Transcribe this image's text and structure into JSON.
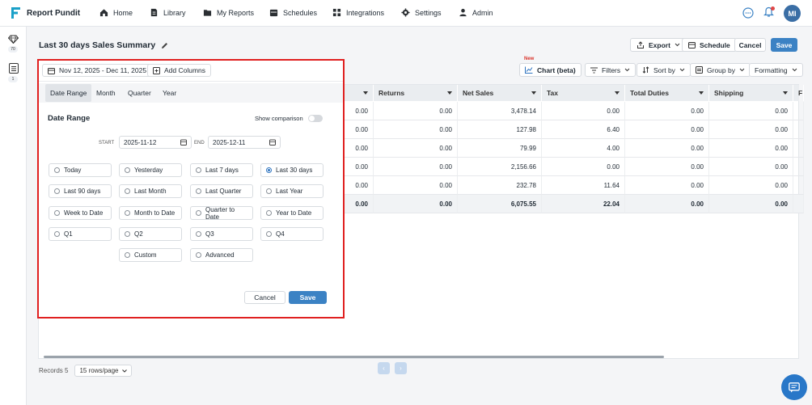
{
  "app": {
    "name": "Report Pundit",
    "avatar_initials": "MI"
  },
  "nav": [
    {
      "label": "Home",
      "icon": "home-icon"
    },
    {
      "label": "Library",
      "icon": "library-icon"
    },
    {
      "label": "My Reports",
      "icon": "folder-icon"
    },
    {
      "label": "Schedules",
      "icon": "calendar-icon"
    },
    {
      "label": "Integrations",
      "icon": "grid-icon"
    },
    {
      "label": "Settings",
      "icon": "gear-icon"
    },
    {
      "label": "Admin",
      "icon": "user-icon"
    }
  ],
  "rail": {
    "templates_count": "70",
    "reports_count": "1"
  },
  "report": {
    "title": "Last 30 days Sales Summary",
    "export_label": "Export",
    "schedule_label": "Schedule",
    "cancel_label": "Cancel",
    "save_label": "Save"
  },
  "toolbar": {
    "new_badge": "New",
    "chart_label": "Chart (beta)",
    "filters_label": "Filters",
    "sort_label": "Sort by",
    "group_label": "Group by",
    "formatting_label": "Formatting"
  },
  "table": {
    "columns": [
      "Returns",
      "Net Sales",
      "Tax",
      "Total Duties",
      "Shipping",
      "F"
    ],
    "rows": [
      [
        "0.00",
        "0.00",
        "3,478.14",
        "0.00",
        "0.00",
        "0.00"
      ],
      [
        "0.00",
        "0.00",
        "127.98",
        "6.40",
        "0.00",
        "0.00"
      ],
      [
        "0.00",
        "0.00",
        "79.99",
        "4.00",
        "0.00",
        "0.00"
      ],
      [
        "0.00",
        "0.00",
        "2,156.66",
        "0.00",
        "0.00",
        "0.00"
      ],
      [
        "0.00",
        "0.00",
        "232.78",
        "11.64",
        "0.00",
        "0.00"
      ]
    ],
    "totals": [
      "0.00",
      "0.00",
      "6,075.55",
      "22.04",
      "0.00",
      "0.00"
    ]
  },
  "footer": {
    "records": "Records 5",
    "rows_per_page": "15 rows/page",
    "prev": "‹",
    "next": "›"
  },
  "date_panel": {
    "range_chip": "Nov 12, 2025 - Dec 11, 2025",
    "add_columns": "Add Columns",
    "tabs": [
      "Date Range",
      "Month",
      "Quarter",
      "Year"
    ],
    "section_title": "Date Range",
    "show_comparison": "Show comparison",
    "start_label": "START",
    "start_value": "2025-11-12",
    "end_label": "END",
    "end_value": "2025-12-11",
    "options": [
      [
        "Today",
        "Yesterday",
        "Last 7 days",
        "Last 30 days"
      ],
      [
        "Last 90 days",
        "Last Month",
        "Last Quarter",
        "Last Year"
      ],
      [
        "Week to Date",
        "Month to Date",
        "Quarter to Date",
        "Year to Date"
      ],
      [
        "Q1",
        "Q2",
        "Q3",
        "Q4"
      ],
      [
        "",
        "Custom",
        "Advanced",
        ""
      ]
    ],
    "selected_option": "Last 30 days",
    "cancel_label": "Cancel",
    "save_label": "Save"
  }
}
